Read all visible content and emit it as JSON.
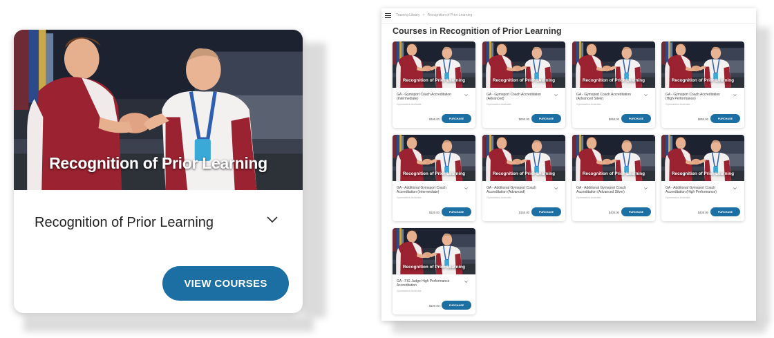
{
  "big_card": {
    "image_caption": "Recognition of Prior Learning",
    "title": "Recognition of Prior Learning",
    "button_label": "VIEW COURSES"
  },
  "panel": {
    "breadcrumb": [
      "Training Library",
      ">",
      "Recognition of Prior Learning"
    ],
    "heading": "Courses in Recognition of Prior Learning",
    "image_caption": "Recognition of Prior Learning",
    "purchase_label": "PURCHASE",
    "courses": [
      {
        "name": "GA - Gymsport Coach Accreditation (Intermediate)",
        "org": "Gymnastics Australia",
        "price": "$165.00"
      },
      {
        "name": "GA - Gymsport Coach Accreditation (Advanced)",
        "org": "Gymnastics Australia",
        "price": "$600.00"
      },
      {
        "name": "GA - Gymsport Coach Accreditation (Advanced Silver)",
        "org": "Gymnastics Australia",
        "price": "$650.00"
      },
      {
        "name": "GA - Gymsport Coach Accreditation (High Performance)",
        "org": "Gymnastics Australia",
        "price": "$850.00"
      },
      {
        "name": "GA - Additional Gymsport Coach Accreditation (Intermediate)",
        "org": "Gymnastics Australia",
        "price": "$100.00"
      },
      {
        "name": "GA - Additional Gymsport Coach Accreditation (Advanced)",
        "org": "Gymnastics Australia",
        "price": "$150.00"
      },
      {
        "name": "GA - Additional Gymsport Coach Accreditation (Advanced Silver)",
        "org": "Gymnastics Australia",
        "price": "$400.00"
      },
      {
        "name": "GA - Additional Gymsport Coach Accreditation (High Performance)",
        "org": "Gymnastics Australia",
        "price": "$400.00"
      },
      {
        "name": "GA - FIG Judge High Performance Accreditation",
        "org": "Gymnastics Australia",
        "price": "$100.00"
      }
    ]
  },
  "colors": {
    "accent": "#1c6fa2",
    "shirt_red": "#9b2230"
  },
  "icons": [
    "hamburger-icon",
    "chevron-down-icon"
  ]
}
